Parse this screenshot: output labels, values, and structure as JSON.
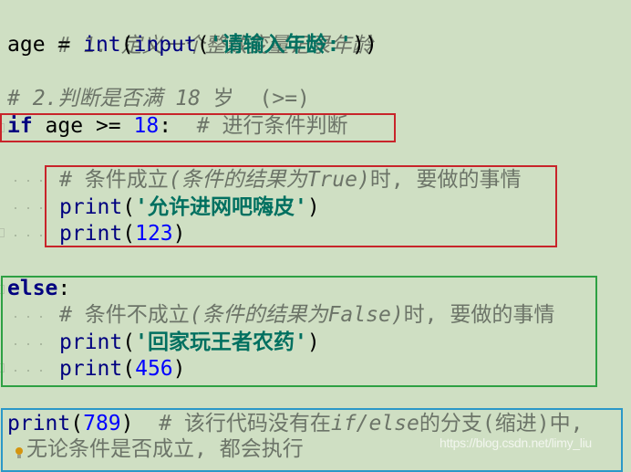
{
  "editor": {
    "theme": {
      "background": "#cfdfc3",
      "comment": "#6c7468",
      "keyword": "#000080",
      "builtin": "#000080",
      "string": "#007060",
      "number": "#0000ff",
      "highlight_red": "#c8242a",
      "highlight_green": "#2ea043",
      "highlight_blue": "#2b98c8"
    },
    "lines": {
      "l1": {
        "comment": "# 1. 定义一个整数变量记录年龄"
      },
      "l2": {
        "var": "age",
        "op": " = ",
        "fn1": "int",
        "p1": "(",
        "fn2": "input",
        "p2": "(",
        "str": "'请输入年龄:'",
        "p3": "))"
      },
      "l4": {
        "comment_a": "# 2.判断是否满 ",
        "comment_num": "18",
        "comment_b": " 岁  (>=)"
      },
      "l5": {
        "kw": "if",
        "mid": " age >= ",
        "num": "18",
        "colon": ":",
        "sp": "  ",
        "comment": "# 进行条件判断"
      },
      "l7": {
        "c1": "# 条件成立",
        "c2": "(条件的结果为",
        "c3": "True",
        "c4": ")",
        "c5": "时, 要做的事情"
      },
      "l8": {
        "fn": "print",
        "p1": "(",
        "str": "'允许进网吧嗨皮'",
        "p2": ")"
      },
      "l9": {
        "fn": "print",
        "p1": "(",
        "num": "123",
        "p2": ")"
      },
      "l11": {
        "kw": "else",
        "colon": ":"
      },
      "l12": {
        "c1": "# 条件不成立",
        "c2": "(条件的结果为",
        "c3": "False",
        "c4": ")",
        "c5": "时, 要做的事情"
      },
      "l13": {
        "fn": "print",
        "p1": "(",
        "str": "'回家玩王者农药'",
        "p2": ")"
      },
      "l14": {
        "fn": "print",
        "p1": "(",
        "num": "456",
        "p2": ")"
      },
      "l16": {
        "fn": "print",
        "p1": "(",
        "num": "789",
        "p2": ")",
        "sp": "  ",
        "c1": "# 该行代码没有在",
        "c2": "if/else",
        "c3": "的分支",
        "c4": "(缩进)",
        "c5": "中,"
      },
      "l17": {
        "comment": "无论条件是否成立, 都会执行"
      }
    }
  },
  "watermark": "https://blog.csdn.net/limy_liu"
}
